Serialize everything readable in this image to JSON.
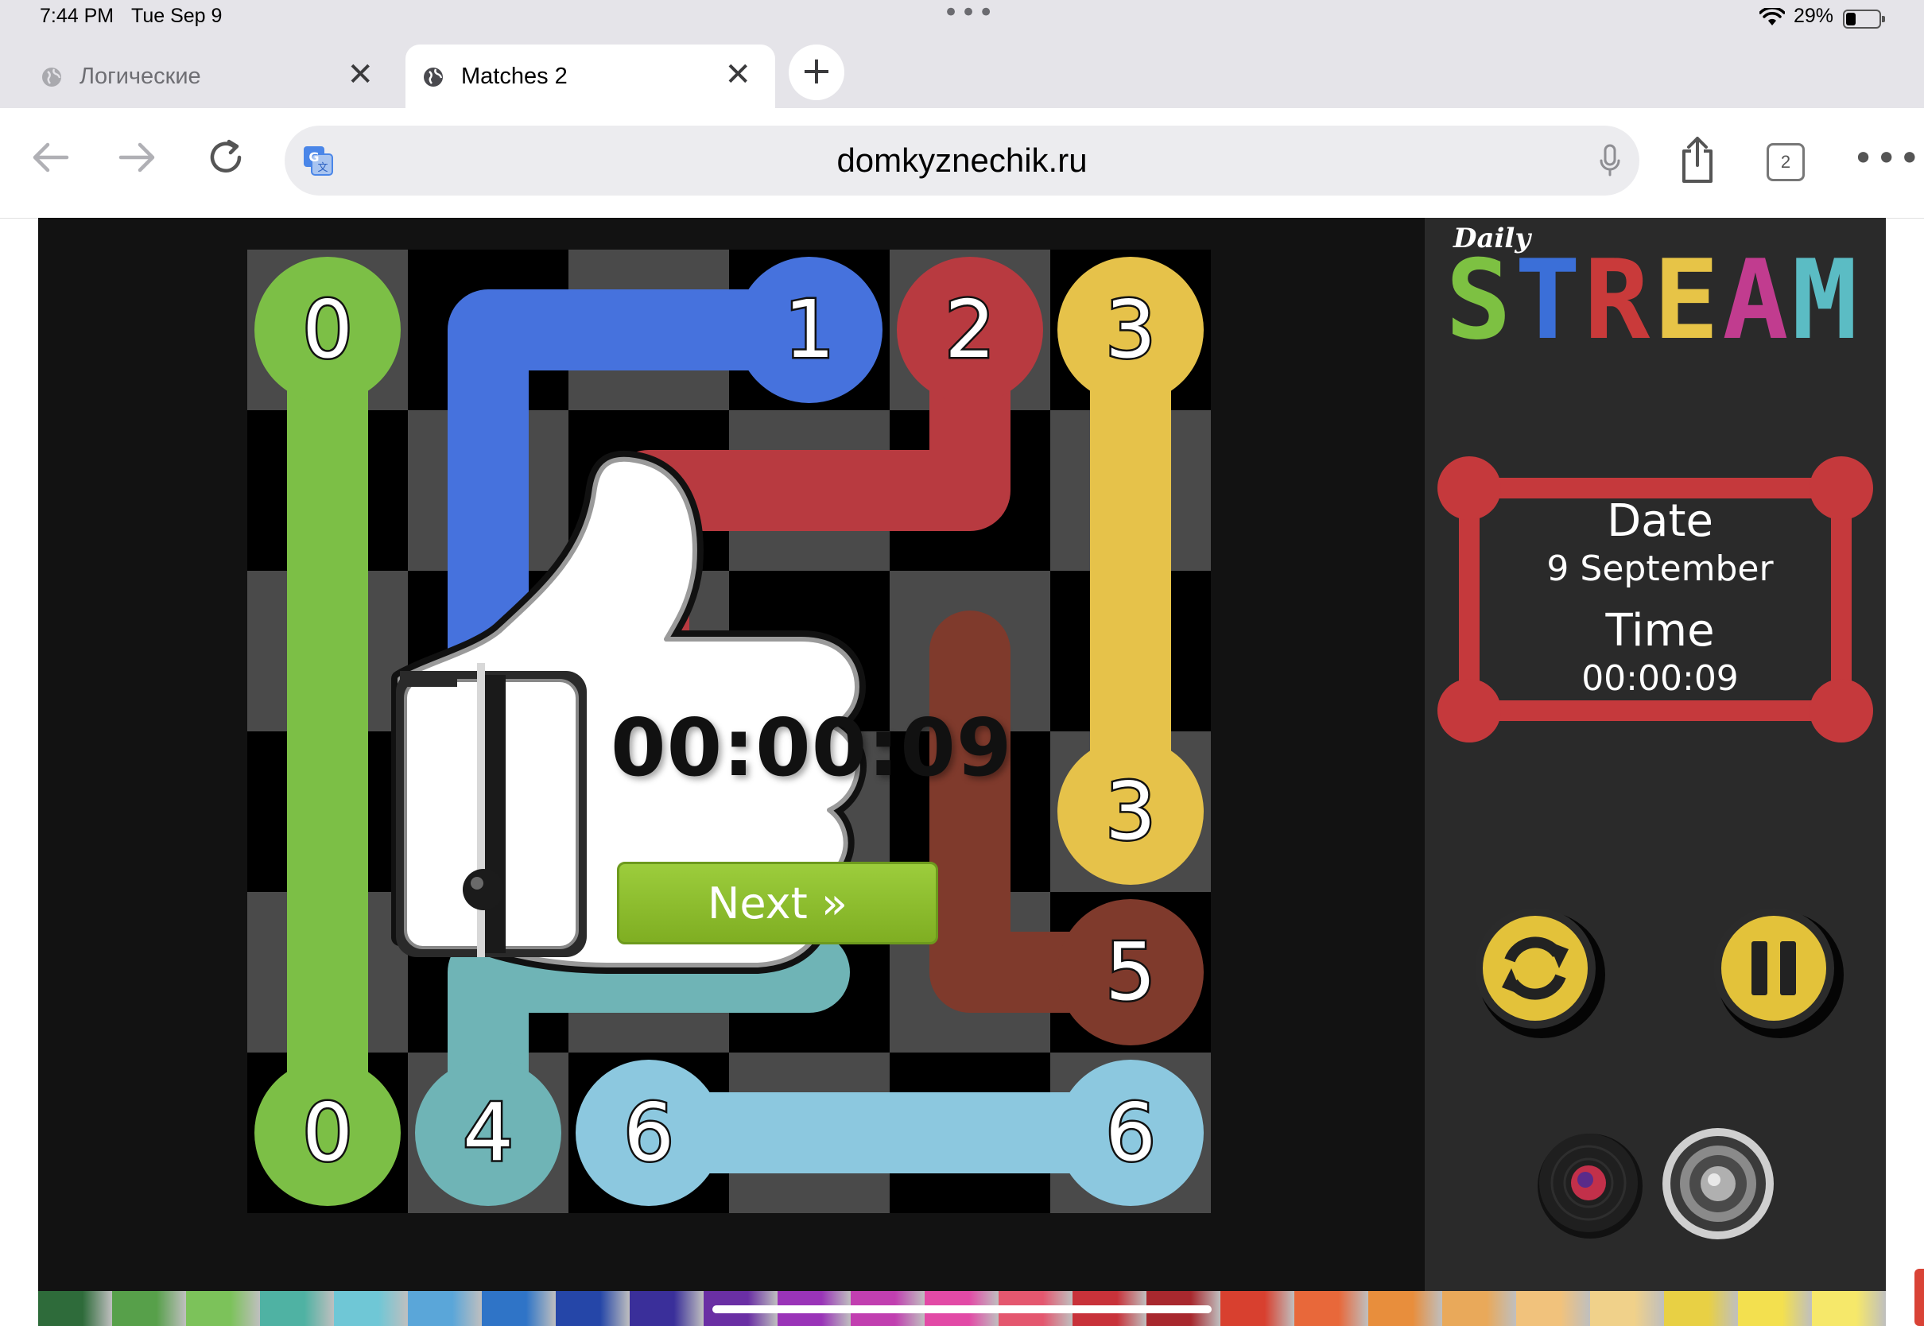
{
  "status_bar": {
    "time": "7:44 PM",
    "date": "Tue Sep 9",
    "battery": "29%",
    "battery_level": 0.29
  },
  "tabs": [
    {
      "label": "Логические",
      "active": false
    },
    {
      "label": "Matches 2",
      "active": true
    }
  ],
  "toolbar": {
    "url": "domkyznechik.ru",
    "tab_count": "2"
  },
  "game": {
    "logo_daily": "Daily",
    "logo_stream": [
      "S",
      "T",
      "R",
      "E",
      "A",
      "M"
    ],
    "logo_colors": [
      "#7dc142",
      "#3b6fd8",
      "#c93a3a",
      "#e7c447",
      "#c13c8f",
      "#5bbcc4"
    ],
    "date_label": "Date",
    "date_value": "9 September",
    "time_label": "Time",
    "time_value": "00:00:09",
    "overlay_time": "00:00:09",
    "next_button": "Next »",
    "grid_size": 6,
    "colors": {
      "green": "#7cbf46",
      "blue": "#4672dd",
      "red": "#b83a40",
      "yellow": "#e6c24a",
      "brown": "#7f3a2c",
      "teal": "#6fb4b6",
      "lightblue": "#8cc8df",
      "frame": "#c5393c",
      "button_yellow": "#e3c23a"
    },
    "endpoints": [
      {
        "label": "0",
        "row": 0,
        "col": 0,
        "color": "#7cbf46"
      },
      {
        "label": "1",
        "row": 0,
        "col": 3,
        "color": "#4672dd"
      },
      {
        "label": "2",
        "row": 0,
        "col": 4,
        "color": "#b83a40"
      },
      {
        "label": "3",
        "row": 0,
        "col": 5,
        "color": "#e6c24a"
      },
      {
        "label": "3",
        "row": 3,
        "col": 5,
        "color": "#e6c24a"
      },
      {
        "label": "5",
        "row": 4,
        "col": 5,
        "color": "#7f3a2c"
      },
      {
        "label": "0",
        "row": 5,
        "col": 0,
        "color": "#7cbf46"
      },
      {
        "label": "4",
        "row": 5,
        "col": 1,
        "color": "#6fb4b6"
      },
      {
        "label": "6",
        "row": 5,
        "col": 2,
        "color": "#8cc8df"
      },
      {
        "label": "6",
        "row": 5,
        "col": 5,
        "color": "#8cc8df"
      }
    ],
    "paths": [
      {
        "color": "#7cbf46",
        "cells": [
          [
            0,
            0
          ],
          [
            5,
            0
          ]
        ]
      },
      {
        "color": "#4672dd",
        "cells": [
          [
            0,
            3
          ],
          [
            0,
            1
          ],
          [
            2,
            1
          ],
          [
            3,
            1
          ]
        ]
      },
      {
        "color": "#b83a40",
        "cells": [
          [
            0,
            4
          ],
          [
            1,
            4
          ],
          [
            1,
            2
          ],
          [
            3,
            2
          ]
        ]
      },
      {
        "color": "#e6c24a",
        "cells": [
          [
            0,
            5
          ],
          [
            3,
            5
          ]
        ]
      },
      {
        "color": "#7f3a2c",
        "cells": [
          [
            4,
            5
          ],
          [
            4,
            4
          ],
          [
            2,
            4
          ]
        ]
      },
      {
        "color": "#6fb4b6",
        "cells": [
          [
            5,
            1
          ],
          [
            4,
            1
          ],
          [
            4,
            3
          ]
        ]
      },
      {
        "color": "#8cc8df",
        "cells": [
          [
            5,
            2
          ],
          [
            5,
            5
          ]
        ]
      }
    ],
    "pencil_colors": [
      "#2e6b3a",
      "#57a04a",
      "#7cc25a",
      "#4fb2a3",
      "#6fc7d6",
      "#5aa6d9",
      "#2f74c7",
      "#2546a8",
      "#3a2f9a",
      "#6a2fa4",
      "#9a34b8",
      "#c13fb0",
      "#e24aa6",
      "#e4576f",
      "#c8323a",
      "#a8282e",
      "#d8402f",
      "#e8683a",
      "#e88e3c",
      "#e9a95a",
      "#f1c27c",
      "#f0d18a",
      "#e8d044",
      "#f3e04f",
      "#f6e86a"
    ]
  }
}
